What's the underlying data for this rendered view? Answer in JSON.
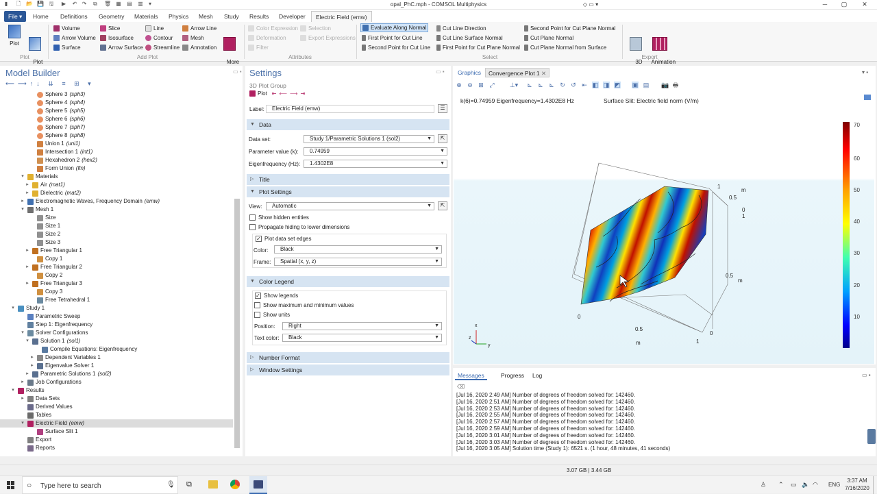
{
  "window": {
    "title": "opal_PhC.mph - COMSOL Multiphysics"
  },
  "ribbon_tabs": [
    "File ▾",
    "Home",
    "Definitions",
    "Geometry",
    "Materials",
    "Physics",
    "Mesh",
    "Study",
    "Results",
    "Developer",
    "Electric Field (emw)"
  ],
  "ribbon": {
    "plot": {
      "plot": "Plot",
      "plot_in": "Plot\nIn ▾",
      "group": "Plot"
    },
    "add_plot": {
      "group": "Add Plot",
      "items": [
        "Volume",
        "Slice",
        "Line",
        "Arrow Line",
        "Arrow Volume",
        "Isosurface",
        "Contour",
        "Mesh",
        "Surface",
        "Arrow Surface",
        "Streamline",
        "Annotation"
      ],
      "more": "More\nPlots ▾"
    },
    "attributes": {
      "group": "Attributes",
      "items": [
        "Color Expression",
        "Selection",
        "Deformation",
        "Export Expressions",
        "Filter"
      ]
    },
    "select": {
      "group": "Select",
      "items": [
        "Evaluate Along Normal",
        "Cut Line Direction",
        "Second Point for Cut Plane Normal",
        "First Point for Cut Line",
        "Cut Line Surface Normal",
        "Cut Plane Normal",
        "Second Point for Cut Line",
        "First Point for Cut Plane Normal",
        "Cut Plane Normal from Surface"
      ]
    },
    "export": {
      "group": "Export",
      "image": "3D\nImage",
      "animation": "Animation\n▾"
    }
  },
  "model_builder": {
    "title": "Model Builder",
    "nodes": [
      {
        "label": "Sphere 3",
        "tag": "(sph3)",
        "lvl": 5,
        "icon": "sphere"
      },
      {
        "label": "Sphere 4",
        "tag": "(sph4)",
        "lvl": 5,
        "icon": "sphere"
      },
      {
        "label": "Sphere 5",
        "tag": "(sph5)",
        "lvl": 5,
        "icon": "sphere"
      },
      {
        "label": "Sphere 6",
        "tag": "(sph6)",
        "lvl": 5,
        "icon": "sphere"
      },
      {
        "label": "Sphere 7",
        "tag": "(sph7)",
        "lvl": 5,
        "icon": "sphere"
      },
      {
        "label": "Sphere 8",
        "tag": "(sph8)",
        "lvl": 5,
        "icon": "sphere"
      },
      {
        "label": "Union 1",
        "tag": "(uni1)",
        "lvl": 5,
        "icon": "union"
      },
      {
        "label": "Intersection 1",
        "tag": "(int1)",
        "lvl": 5,
        "icon": "union"
      },
      {
        "label": "Hexahedron 2",
        "tag": "(hex2)",
        "lvl": 5,
        "icon": "hex"
      },
      {
        "label": "Form Union",
        "tag": "(fin)",
        "lvl": 5,
        "icon": "union"
      },
      {
        "label": "Materials",
        "tag": "",
        "lvl": 3,
        "icon": "mat",
        "exp": "▾"
      },
      {
        "label": "Air",
        "tag": "(mat1)",
        "lvl": 4,
        "icon": "mat",
        "exp": "▸"
      },
      {
        "label": "Dielectric",
        "tag": "(mat2)",
        "lvl": 4,
        "icon": "mat",
        "exp": "▸"
      },
      {
        "label": "Electromagnetic Waves, Frequency Domain",
        "tag": "(emw)",
        "lvl": 3,
        "icon": "emw",
        "exp": "▸"
      },
      {
        "label": "Mesh 1",
        "tag": "",
        "lvl": 3,
        "icon": "mesh",
        "exp": "▾"
      },
      {
        "label": "Size",
        "tag": "",
        "lvl": 5,
        "icon": "size"
      },
      {
        "label": "Size 1",
        "tag": "",
        "lvl": 5,
        "icon": "size"
      },
      {
        "label": "Size 2",
        "tag": "",
        "lvl": 5,
        "icon": "size"
      },
      {
        "label": "Size 3",
        "tag": "",
        "lvl": 5,
        "icon": "size"
      },
      {
        "label": "Free Triangular 1",
        "tag": "",
        "lvl": 4,
        "icon": "tri",
        "exp": "▸"
      },
      {
        "label": "Copy 1",
        "tag": "",
        "lvl": 5,
        "icon": "copy"
      },
      {
        "label": "Free Triangular 2",
        "tag": "",
        "lvl": 4,
        "icon": "tri",
        "exp": "▸"
      },
      {
        "label": "Copy 2",
        "tag": "",
        "lvl": 5,
        "icon": "copy"
      },
      {
        "label": "Free Triangular 3",
        "tag": "",
        "lvl": 4,
        "icon": "tri",
        "exp": "▸"
      },
      {
        "label": "Copy 3",
        "tag": "",
        "lvl": 5,
        "icon": "copy"
      },
      {
        "label": "Free Tetrahedral 1",
        "tag": "",
        "lvl": 5,
        "icon": "tet"
      },
      {
        "label": "Study 1",
        "tag": "",
        "lvl": 1,
        "icon": "study",
        "exp": "▾"
      },
      {
        "label": "Parametric Sweep",
        "tag": "",
        "lvl": 3,
        "icon": "sweep"
      },
      {
        "label": "Step 1: Eigenfrequency",
        "tag": "",
        "lvl": 3,
        "icon": "step"
      },
      {
        "label": "Solver Configurations",
        "tag": "",
        "lvl": 3,
        "icon": "solver",
        "exp": "▾"
      },
      {
        "label": "Solution 1",
        "tag": "(sol1)",
        "lvl": 4,
        "icon": "sol",
        "exp": "▾"
      },
      {
        "label": "Compile Equations: Eigenfrequency",
        "tag": "",
        "lvl": 6,
        "icon": "ce"
      },
      {
        "label": "Dependent Variables 1",
        "tag": "",
        "lvl": 5,
        "icon": "dv",
        "exp": "▸"
      },
      {
        "label": "Eigenvalue Solver 1",
        "tag": "",
        "lvl": 5,
        "icon": "ev",
        "exp": "▸"
      },
      {
        "label": "Parametric Solutions 1",
        "tag": "(sol2)",
        "lvl": 4,
        "icon": "sol",
        "exp": "▸"
      },
      {
        "label": "Job Configurations",
        "tag": "",
        "lvl": 3,
        "icon": "job",
        "exp": "▸"
      },
      {
        "label": "Results",
        "tag": "",
        "lvl": 1,
        "icon": "results",
        "exp": "▾"
      },
      {
        "label": "Data Sets",
        "tag": "",
        "lvl": 3,
        "icon": "ds",
        "exp": "▸"
      },
      {
        "label": "Derived Values",
        "tag": "",
        "lvl": 3,
        "icon": "dv2"
      },
      {
        "label": "Tables",
        "tag": "",
        "lvl": 3,
        "icon": "tables"
      },
      {
        "label": "Electric Field",
        "tag": "(emw)",
        "lvl": 3,
        "icon": "pg",
        "exp": "▾",
        "selected": true
      },
      {
        "label": "Surface Slit 1",
        "tag": "",
        "lvl": 5,
        "icon": "surf"
      },
      {
        "label": "Export",
        "tag": "",
        "lvl": 3,
        "icon": "export"
      },
      {
        "label": "Reports",
        "tag": "",
        "lvl": 3,
        "icon": "reports"
      }
    ]
  },
  "settings": {
    "title": "Settings",
    "subtitle": "3D Plot Group",
    "plot_btn": "Plot",
    "label_caption": "Label:",
    "label_value": "Electric Field (emw)",
    "sec_data": "Data",
    "dataset_caption": "Data set:",
    "dataset_value": "Study 1/Parametric Solutions 1 (sol2)",
    "param_caption": "Parameter value (k):",
    "param_value": "0.74959",
    "eigen_caption": "Eigenfrequency (Hz):",
    "eigen_value": "1.4302E8",
    "sec_title": "Title",
    "sec_plot": "Plot Settings",
    "view_caption": "View:",
    "view_value": "Automatic",
    "show_hidden": "Show hidden entities",
    "propagate": "Propagate hiding to lower dimensions",
    "plot_edges": "Plot data set edges",
    "color_caption": "Color:",
    "color_value": "Black",
    "frame_caption": "Frame:",
    "frame_value": "Spatial  (x, y, z)",
    "sec_legend": "Color Legend",
    "show_legends": "Show legends",
    "show_maxmin": "Show maximum and minimum values",
    "show_units": "Show units",
    "position_caption": "Position:",
    "position_value": "Right",
    "textcolor_caption": "Text color:",
    "textcolor_value": "Black",
    "sec_number": "Number Format",
    "sec_window": "Window Settings"
  },
  "graphics": {
    "tab_graphics": "Graphics",
    "tab_convergence": "Convergence Plot 1",
    "header_left": "k(6)=0.74959 Eigenfrequency=1.4302E8 Hz",
    "header_right": "Surface Slit: Electric field norm (V/m)",
    "legend_ticks": [
      "70",
      "60",
      "50",
      "40",
      "30",
      "20",
      "10"
    ],
    "axis_labels": {
      "x_0": "0",
      "x_05": "0.5",
      "x_1": "1",
      "x_m": "m",
      "y_0": "0",
      "y_05": "0.5",
      "y_m": "m",
      "y_1": "1",
      "z_1": "1",
      "z_05": "0.5",
      "z_0": "0",
      "z_1b": "1",
      "z_m": "m"
    },
    "triad": {
      "x": "x",
      "y": "y",
      "z": "z"
    }
  },
  "messages": {
    "tabs": [
      "Messages",
      "Progress",
      "Log"
    ],
    "lines": [
      "[Jul 16, 2020 2:49 AM] Number of degrees of freedom solved for: 142460.",
      "[Jul 16, 2020 2:51 AM] Number of degrees of freedom solved for: 142460.",
      "[Jul 16, 2020 2:53 AM] Number of degrees of freedom solved for: 142460.",
      "[Jul 16, 2020 2:55 AM] Number of degrees of freedom solved for: 142460.",
      "[Jul 16, 2020 2:57 AM] Number of degrees of freedom solved for: 142460.",
      "[Jul 16, 2020 2:59 AM] Number of degrees of freedom solved for: 142460.",
      "[Jul 16, 2020 3:01 AM] Number of degrees of freedom solved for: 142460.",
      "[Jul 16, 2020 3:03 AM] Number of degrees of freedom solved for: 142460.",
      "[Jul 16, 2020 3:05 AM] Solution time (Study 1): 6521 s. (1 hour, 48 minutes, 41 seconds)"
    ]
  },
  "status": {
    "memory": "3.07 GB | 3.44 GB"
  },
  "taskbar": {
    "search_placeholder": "Type here to search",
    "lang": "ENG",
    "time": "3:37 AM",
    "date": "7/16/2020"
  }
}
